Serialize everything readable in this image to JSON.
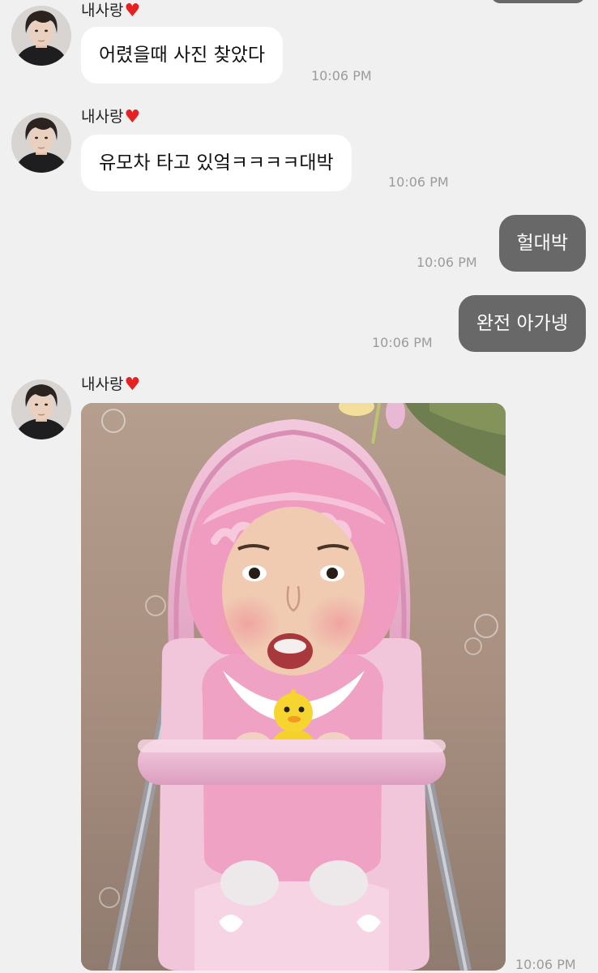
{
  "messages": [
    {
      "type": "incoming",
      "sender": "내사랑",
      "text": "어렸을때 사진 찾았다",
      "time": "10:06 PM"
    },
    {
      "type": "incoming",
      "sender": "내사랑",
      "text": "유모차 타고 있엌ㅋㅋㅋㅋ대박",
      "time": "10:06 PM"
    },
    {
      "type": "outgoing",
      "text": "헐대박",
      "time": "10:06 PM"
    },
    {
      "type": "outgoing",
      "text": "완전 아가넹",
      "time": "10:06 PM"
    },
    {
      "type": "incoming-image",
      "sender": "내사랑",
      "time": "10:06 PM"
    }
  ],
  "icons": {
    "heart": "heart-icon"
  },
  "colors": {
    "background": "#f0f0f0",
    "incoming_bubble": "#ffffff",
    "outgoing_bubble": "#686868",
    "timestamp": "#9b9b9b",
    "heart": "#e52222"
  }
}
